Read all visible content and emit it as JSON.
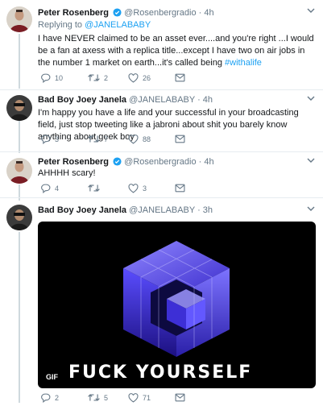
{
  "tweets": [
    {
      "name": "Peter Rosenberg",
      "handle": "@Rosenbergradio",
      "time": "· 4h",
      "verified": true,
      "reply_prefix": "Replying to ",
      "reply_handle": "@JANELABABY",
      "text": "I have NEVER claimed to be an asset ever....and you're right ...I would be a fan at axess with a replica title...except I have two on air jobs in the number 1 market on earth...it's called being ",
      "hashtag": "#withalife",
      "replies": "10",
      "retweets": "2",
      "likes": "26"
    },
    {
      "name": "Bad Boy Joey Janela",
      "handle": "@JANELABABY",
      "time": "· 4h",
      "text": "I'm happy you have a life and your successful in your broadcasting field,  just stop tweeting like a jabroni about shit you barely know anything about geek boy",
      "replies": "3",
      "retweets": "7",
      "likes": "88"
    },
    {
      "name": "Peter Rosenberg",
      "handle": "@Rosenbergradio",
      "time": "· 4h",
      "verified": true,
      "text": "AHHHH scary!",
      "replies": "4",
      "retweets": "",
      "likes": "3"
    },
    {
      "name": "Bad Boy Joey Janela",
      "handle": "@JANELABABY",
      "time": "· 3h",
      "gif_badge": "GIF",
      "gif_caption": "FUCK YOURSELF",
      "replies": "2",
      "retweets": "5",
      "likes": "71"
    }
  ],
  "colors": {
    "accent": "#1da1f2",
    "muted": "#657786",
    "text": "#14171a",
    "gif_cube": "#4b3cff"
  },
  "icons": [
    "reply-icon",
    "retweet-icon",
    "like-icon",
    "message-icon",
    "chevron-down-icon",
    "verified-icon"
  ]
}
